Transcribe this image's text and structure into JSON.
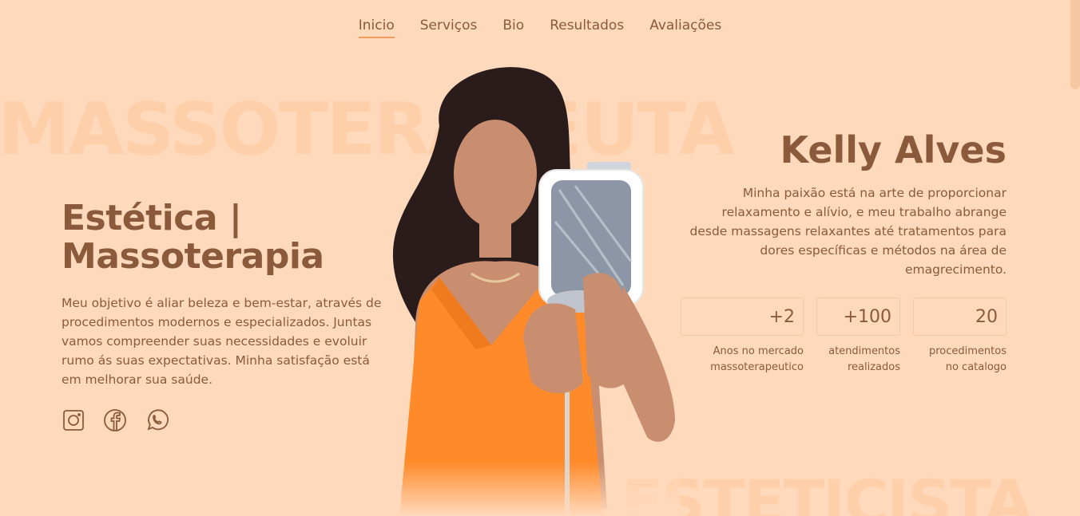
{
  "nav": {
    "items": [
      {
        "label": "Inicio",
        "active": true
      },
      {
        "label": "Serviços"
      },
      {
        "label": "Bio"
      },
      {
        "label": "Resultados"
      },
      {
        "label": "Avaliações"
      }
    ]
  },
  "background_words": {
    "top": "MASSOTERAPEUTA",
    "bottom": "ESTETICISTA"
  },
  "hero": {
    "title_line1": "Estética |",
    "title_line2": "Massoterapia",
    "description": "Meu objetivo é aliar beleza e bem-estar, através de procedimentos modernos e especializados. Juntas vamos compreender suas necessidades e evoluir rumo ás suas expectativas. Minha satisfação está em melhorar sua saúde.",
    "social_icons": [
      "instagram-icon",
      "facebook-icon",
      "whatsapp-icon"
    ]
  },
  "profile": {
    "name": "Kelly Alves",
    "bio": "Minha paixão está na arte de proporcionar relaxamento e alívio, e meu trabalho abrange desde massagens relaxantes até tratamentos para dores específicas e métodos na área de emagrecimento."
  },
  "stats": [
    {
      "value": "+2",
      "label_line1": "Anos no mercado",
      "label_line2": "massoterapeutico"
    },
    {
      "value": "+100",
      "label_line1": "atendimentos",
      "label_line2": "realizados"
    },
    {
      "value": "20",
      "label_line1": "procedimentos",
      "label_line2": "no catalogo"
    }
  ],
  "colors": {
    "background": "#ffd9bc",
    "text": "#8a5a3b",
    "accent": "#f09a5c",
    "dress": "#ff8a2a"
  }
}
